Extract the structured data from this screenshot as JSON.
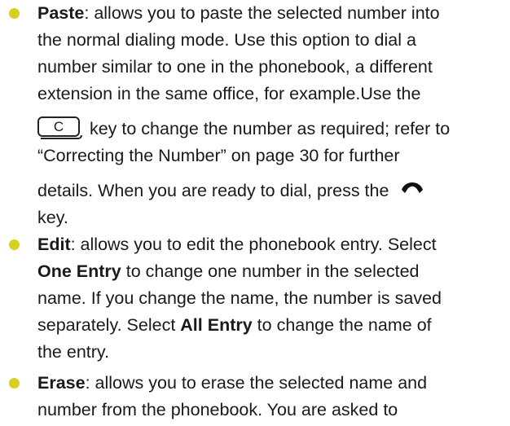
{
  "items": [
    {
      "term": "Paste",
      "lines": [
        ": allows you to paste the selected number into",
        "the normal dialing mode. Use this option to dial a",
        "number similar to one in the phonebook, a different",
        "extension in the same office, for example.Use the",
        " key to change the number as required; refer to",
        "“Correcting the Number” on page 30 for further",
        "details. When you are ready to dial, press the ",
        "key."
      ],
      "key_label": "C",
      "icons": [
        "c-key-icon",
        "send-handset-icon"
      ]
    },
    {
      "term": "Edit",
      "lines": [
        ": allows you to edit the phonebook entry. Select",
        "One Entry",
        " to change one number in the selected",
        "name. If you change the name, the number is saved",
        "separately. Select ",
        "All Entry",
        " to change the name of",
        "the entry."
      ]
    },
    {
      "term": "Erase",
      "lines": [
        ": allows you to erase the selected name and",
        "number from the phonebook. You are asked to"
      ]
    }
  ],
  "colors": {
    "bullet": "#d8d01e",
    "text": "#1a1a1a"
  }
}
